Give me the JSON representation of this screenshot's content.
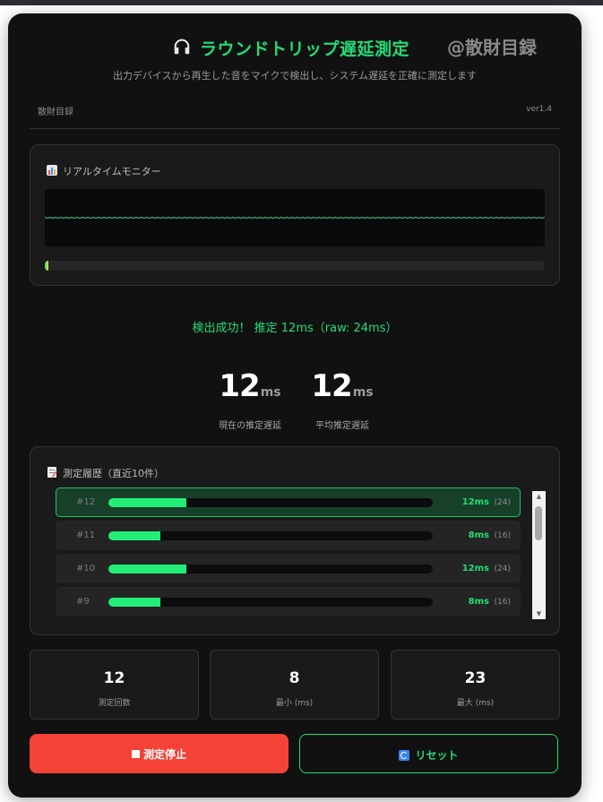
{
  "header": {
    "icon": "headphones-icon",
    "title": "ラウンドトリップ遅延測定",
    "watermark": "@散財目録",
    "subtitle": "出力デバイスから再生した音をマイクで検出し、システム遅延を正確に測定します",
    "author": "散財目録",
    "version": "ver1.4"
  },
  "monitor": {
    "icon": "bar-chart-icon",
    "title": "リアルタイムモニター",
    "level_fraction": 0.008,
    "wave_color": "#3a9e6a"
  },
  "status": {
    "message": "検出成功！ 推定 12ms（raw: 24ms）"
  },
  "stats": {
    "current": {
      "value": "12",
      "unit": "ms",
      "label": "現在の推定遅延"
    },
    "average": {
      "value": "12",
      "unit": "ms",
      "label": "平均推定遅延"
    }
  },
  "history": {
    "icon": "memo-icon",
    "title": "測定履歴（直近10件）",
    "bar_max_ms": 50,
    "rows": [
      {
        "index": "#12",
        "ms_value": 12,
        "ms": "12ms",
        "raw": "(24)",
        "current": true
      },
      {
        "index": "#11",
        "ms_value": 8,
        "ms": "8ms",
        "raw": "(16)",
        "current": false
      },
      {
        "index": "#10",
        "ms_value": 12,
        "ms": "12ms",
        "raw": "(24)",
        "current": false
      },
      {
        "index": "#9",
        "ms_value": 8,
        "ms": "8ms",
        "raw": "(16)",
        "current": false
      }
    ]
  },
  "summary": [
    {
      "value": "12",
      "label": "測定回数"
    },
    {
      "value": "8",
      "label": "最小 (ms)"
    },
    {
      "value": "23",
      "label": "最大 (ms)"
    }
  ],
  "buttons": {
    "stop": {
      "icon": "stop-square-icon",
      "label": "測定停止"
    },
    "reset": {
      "icon": "refresh-icon",
      "label": "リセット"
    }
  },
  "colors": {
    "accent": "#22dd77",
    "danger": "#f44336",
    "background": "#111111"
  }
}
